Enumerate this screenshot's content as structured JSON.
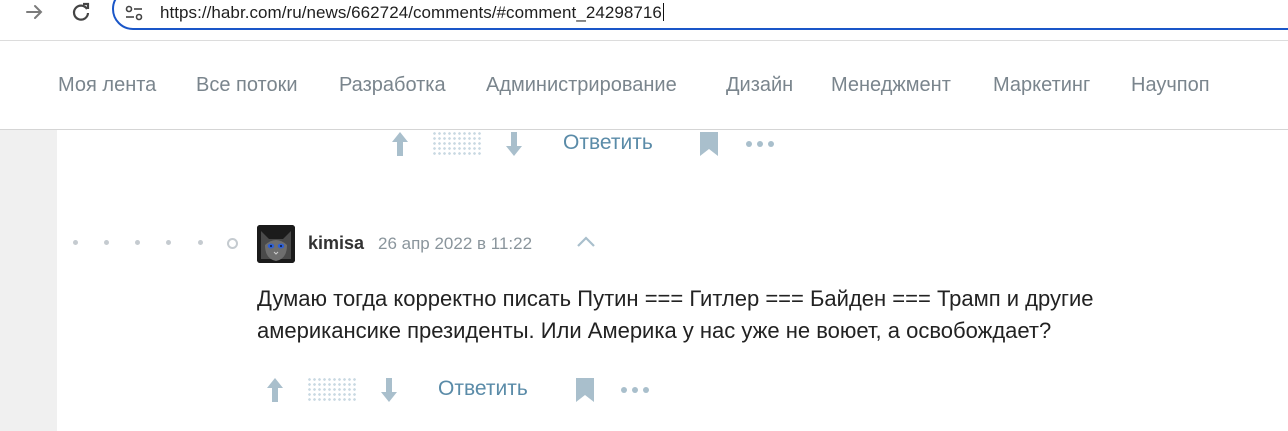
{
  "browser": {
    "url": "https://habr.com/ru/news/662724/comments/#comment_24298716"
  },
  "nav": {
    "items": [
      "Моя лента",
      "Все потоки",
      "Разработка",
      "Администрирование",
      "Дизайн",
      "Менеджмент",
      "Маркетинг",
      "Научпоп"
    ]
  },
  "prev_comment": {
    "reply_label": "Ответить"
  },
  "comment": {
    "author": "kimisa",
    "timestamp": "26 апр 2022 в 11:22",
    "text_line1": "Думаю тогда корректно писать Путин === Гитлер === Байден === Трамп и другие",
    "text_line2": "американсике президенты. Или Америка у нас уже не воюет, а освобождает?",
    "reply_label": "Ответить"
  },
  "colors": {
    "accent": "#5a8ba8",
    "icon": "#a9bfcc",
    "omnibox_border": "#1a56c8"
  }
}
